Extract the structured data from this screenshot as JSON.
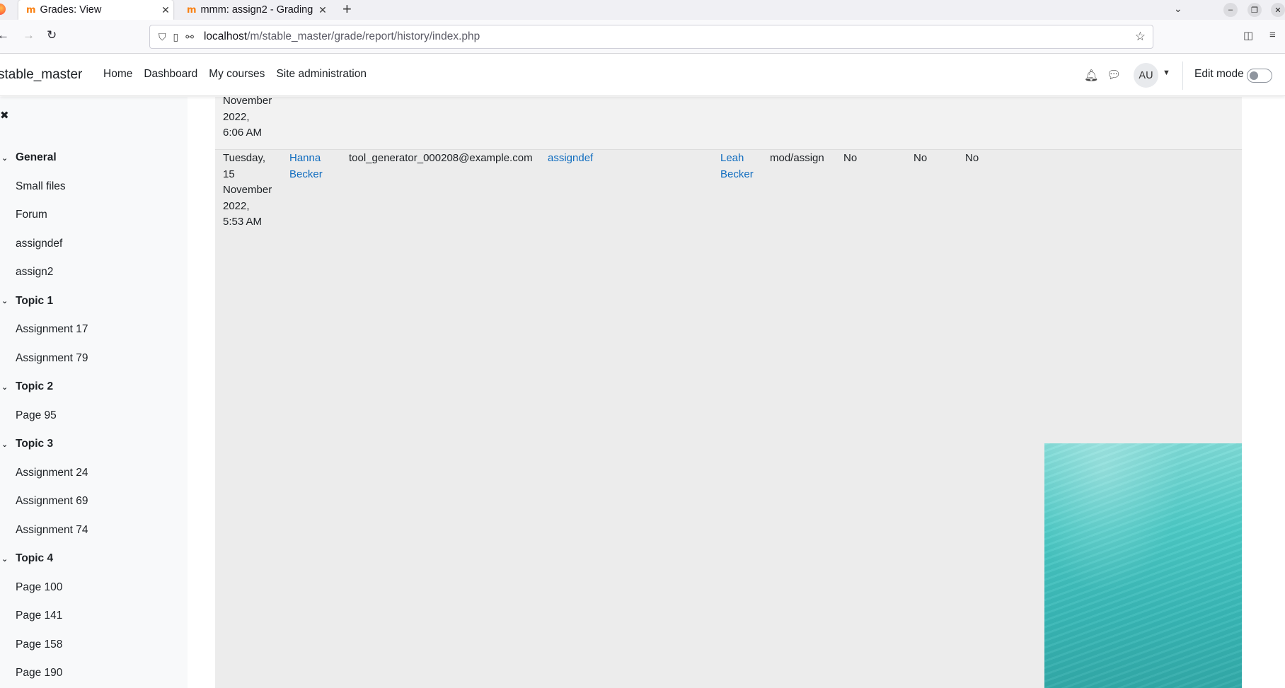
{
  "browser": {
    "tabs": [
      {
        "title": "Grades: View",
        "favicon": "m",
        "active": true
      },
      {
        "title": "mmm: assign2 - Grading",
        "favicon": "m",
        "active": false
      }
    ],
    "url_host": "localhost",
    "url_path": "/m/stable_master/grade/report/history/index.php"
  },
  "header": {
    "site_name": "stable_master",
    "nav": [
      "Home",
      "Dashboard",
      "My courses",
      "Site administration"
    ],
    "avatar_initials": "AU",
    "edit_mode_label": "Edit mode",
    "edit_mode_on": false
  },
  "course_index": [
    {
      "type": "section",
      "label": "General"
    },
    {
      "type": "activity",
      "label": "Small files"
    },
    {
      "type": "activity",
      "label": "Forum"
    },
    {
      "type": "activity",
      "label": "assigndef"
    },
    {
      "type": "activity",
      "label": "assign2"
    },
    {
      "type": "section",
      "label": "Topic 1"
    },
    {
      "type": "activity",
      "label": "Assignment 17"
    },
    {
      "type": "activity",
      "label": "Assignment 79"
    },
    {
      "type": "section",
      "label": "Topic 2"
    },
    {
      "type": "activity",
      "label": "Page 95"
    },
    {
      "type": "section",
      "label": "Topic 3"
    },
    {
      "type": "activity",
      "label": "Assignment 24"
    },
    {
      "type": "activity",
      "label": "Assignment 69"
    },
    {
      "type": "activity",
      "label": "Assignment 74"
    },
    {
      "type": "section",
      "label": "Topic 4"
    },
    {
      "type": "activity",
      "label": "Page 100"
    },
    {
      "type": "activity",
      "label": "Page 141"
    },
    {
      "type": "activity",
      "label": "Page 158"
    },
    {
      "type": "activity",
      "label": "Page 190"
    }
  ],
  "history": {
    "prev_row_date_tail": [
      "November",
      "2022,",
      "6:06 AM"
    ],
    "row": {
      "date": [
        "Tuesday,",
        "15",
        "November",
        "2022,",
        "5:53 AM"
      ],
      "user_first": "Hanna",
      "user_last": "Becker",
      "email": "tool_generator_000208@example.com",
      "grade_item": "assigndef",
      "grader_first": "Leah",
      "grader_last": "Becker",
      "source": "mod/assign",
      "overridden": "No",
      "locked": "No",
      "excluded": "No"
    }
  }
}
